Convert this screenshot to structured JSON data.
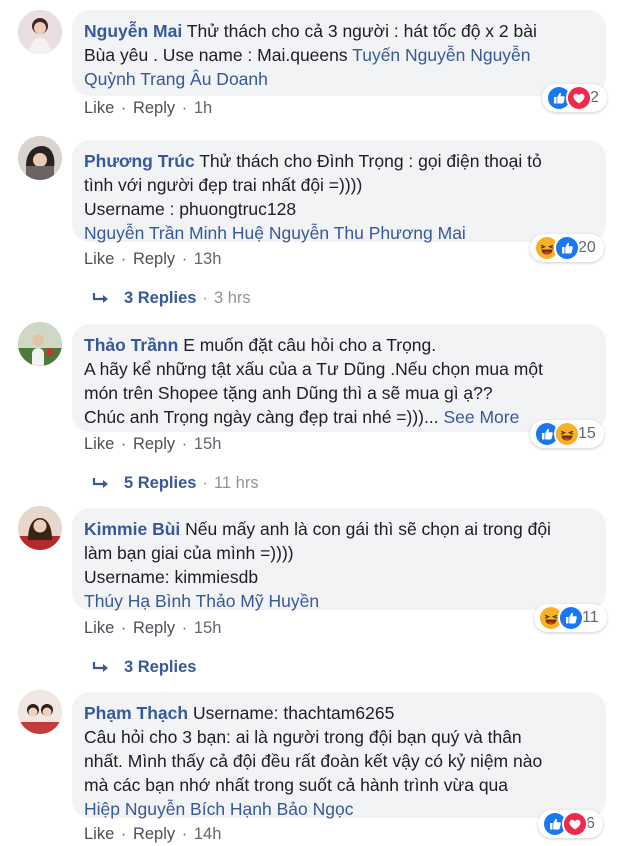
{
  "comments": [
    {
      "name": "Nguyễn Mai",
      "lines": [
        "Thử thách cho cả 3 người : hát tốc độ x 2 bài",
        "Bùa yêu . Use name : Mai.queens"
      ],
      "tags_inline": "Tuyến Nguyễn Nguyễn",
      "tags_line": "Quỳnh Trang Âu Doanh",
      "like": "Like",
      "reply": "Reply",
      "time": "1h",
      "reaction_count": "2"
    },
    {
      "name": "Phương Trúc",
      "line1": "Thử thách cho Đình Trọng : gọi điện thoại tỏ",
      "line2": "tình với người đẹp trai nhất đội =))))",
      "line3": "Username : phuongtruc128",
      "tags_line": "Nguyễn Trần Minh Huệ Nguyễn Thu Phương Mai",
      "like": "Like",
      "reply": "Reply",
      "time": "13h",
      "reaction_count": "20",
      "replies": "3 Replies",
      "replies_time": "3 hrs"
    },
    {
      "name": "Thảo Trầnn",
      "line1": "E muốn đặt câu hỏi cho a Trọng.",
      "line2": "A hãy kể những tật xấu của a Tư Dũng .Nếu chọn mua một",
      "line3": "món trên Shopee tặng anh Dũng thì a sẽ mua gì ạ??",
      "line4": "Chúc anh Trọng ngày càng đẹp trai nhé =)))...",
      "see_more": "See More",
      "like": "Like",
      "reply": "Reply",
      "time": "15h",
      "reaction_count": "15",
      "replies": "5 Replies",
      "replies_time": "11 hrs"
    },
    {
      "name": "Kimmie Bùi",
      "line1": "Nếu mấy anh là con gái thì sẽ chọn ai trong đội",
      "line2": "làm bạn giai của mình =))))",
      "line3": "Username: kimmiesdb",
      "tags_line": "Thúy Hạ Bình Thảo Mỹ Huyền",
      "like": "Like",
      "reply": "Reply",
      "time": "15h",
      "reaction_count": "11",
      "replies": "3 Replies"
    },
    {
      "name": "Phạm Thạch",
      "line1": "Username: thachtam6265",
      "line2": "Câu hỏi cho 3 bạn: ai là người trong đội bạn quý và thân",
      "line3": "nhất. Mình thấy cả đội đều rất đoàn kết vậy có kỷ niệm nào",
      "line4": "mà các bạn nhớ nhất trong suốt cả hành trình vừa qua",
      "tags_line": "Hiệp Nguyễn Bích Hạnh Bảo Ngọc",
      "like": "Like",
      "reply": "Reply",
      "time": "14h",
      "reaction_count": "6"
    }
  ],
  "colors": {
    "link": "#385898",
    "bubble": "#f2f3f5",
    "like_blue": "#1877f2",
    "love_red": "#f0284a",
    "haha_yellow": "#f7b125"
  },
  "icons": [
    "like-reaction-icon",
    "love-reaction-icon",
    "haha-reaction-icon",
    "reply-arrow-icon"
  ]
}
